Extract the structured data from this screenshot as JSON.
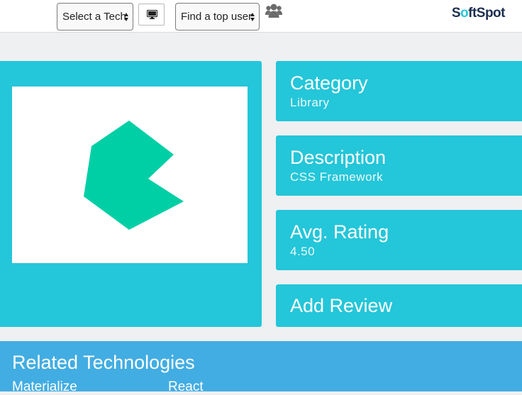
{
  "navbar": {
    "tech_select": "Select a Tech",
    "user_select": "Find a top user",
    "logo": {
      "part1": "S",
      "part2": "ftSpot"
    }
  },
  "details": {
    "category": {
      "title": "Category",
      "value": "Library"
    },
    "description": {
      "title": "Description",
      "value": "CSS Framework"
    },
    "rating": {
      "title": "Avg. Rating",
      "value": "4.50"
    },
    "add_review": "Add Review"
  },
  "related": {
    "title": "Related Technologies",
    "items": [
      "Materialize",
      "React"
    ]
  },
  "colors": {
    "panel": "#24c6d9",
    "related_bg": "#42ade2",
    "logo_shape": "#00cfa6"
  }
}
